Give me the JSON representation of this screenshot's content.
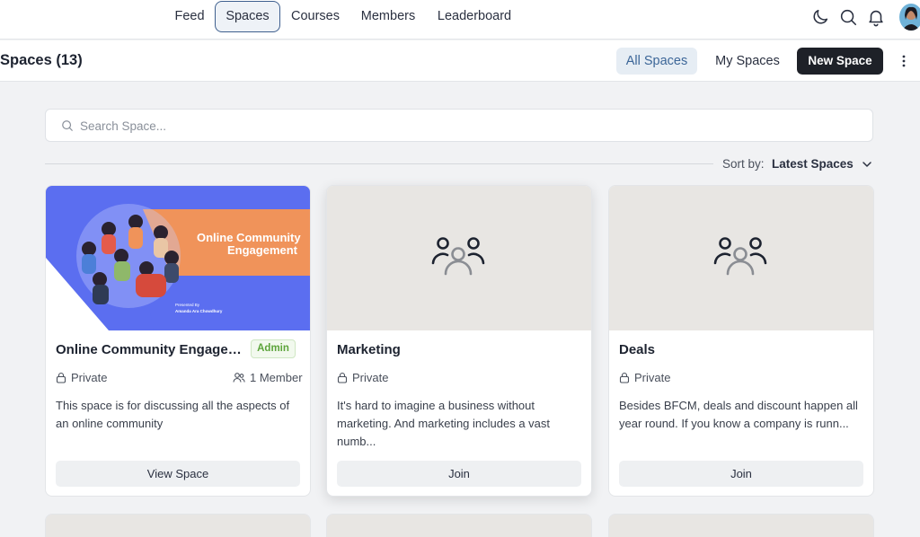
{
  "nav": {
    "items": [
      {
        "label": "Feed",
        "active": false
      },
      {
        "label": "Spaces",
        "active": true
      },
      {
        "label": "Courses",
        "active": false
      },
      {
        "label": "Members",
        "active": false
      },
      {
        "label": "Leaderboard",
        "active": false
      }
    ],
    "icons": [
      "moon-icon",
      "search-icon",
      "bell-icon"
    ]
  },
  "header": {
    "title": "Spaces (13)",
    "tab_all": "All Spaces",
    "tab_my": "My Spaces",
    "new_space": "New Space"
  },
  "search": {
    "placeholder": "Search Space..."
  },
  "sort": {
    "label": "Sort by:",
    "value": "Latest Spaces"
  },
  "cards": [
    {
      "title": "Online Community Engagem...",
      "badge": "Admin",
      "privacy": "Private",
      "members": "1 Member",
      "description": "This space is for discussing all the aspects of an online community",
      "button": "View Space",
      "cover": {
        "heading_line1": "Online Community",
        "heading_line2": "Engagement",
        "presented_by": "Presented By",
        "author": "Amanda Ara Chowdhury"
      }
    },
    {
      "title": "Marketing",
      "privacy": "Private",
      "description": "It's hard to imagine a business without marketing. And marketing includes a vast numb...",
      "button": "Join"
    },
    {
      "title": "Deals",
      "privacy": "Private",
      "description": "Besides BFCM, deals and discount happen all year round. If you know a company is runn...",
      "button": "Join"
    }
  ],
  "colors": {
    "accent": "#3c6698",
    "primary_button": "#1e2128",
    "admin_badge": "#5ca43b",
    "cover_orange": "#f0935a",
    "cover_blue": "#5b6ef0"
  }
}
